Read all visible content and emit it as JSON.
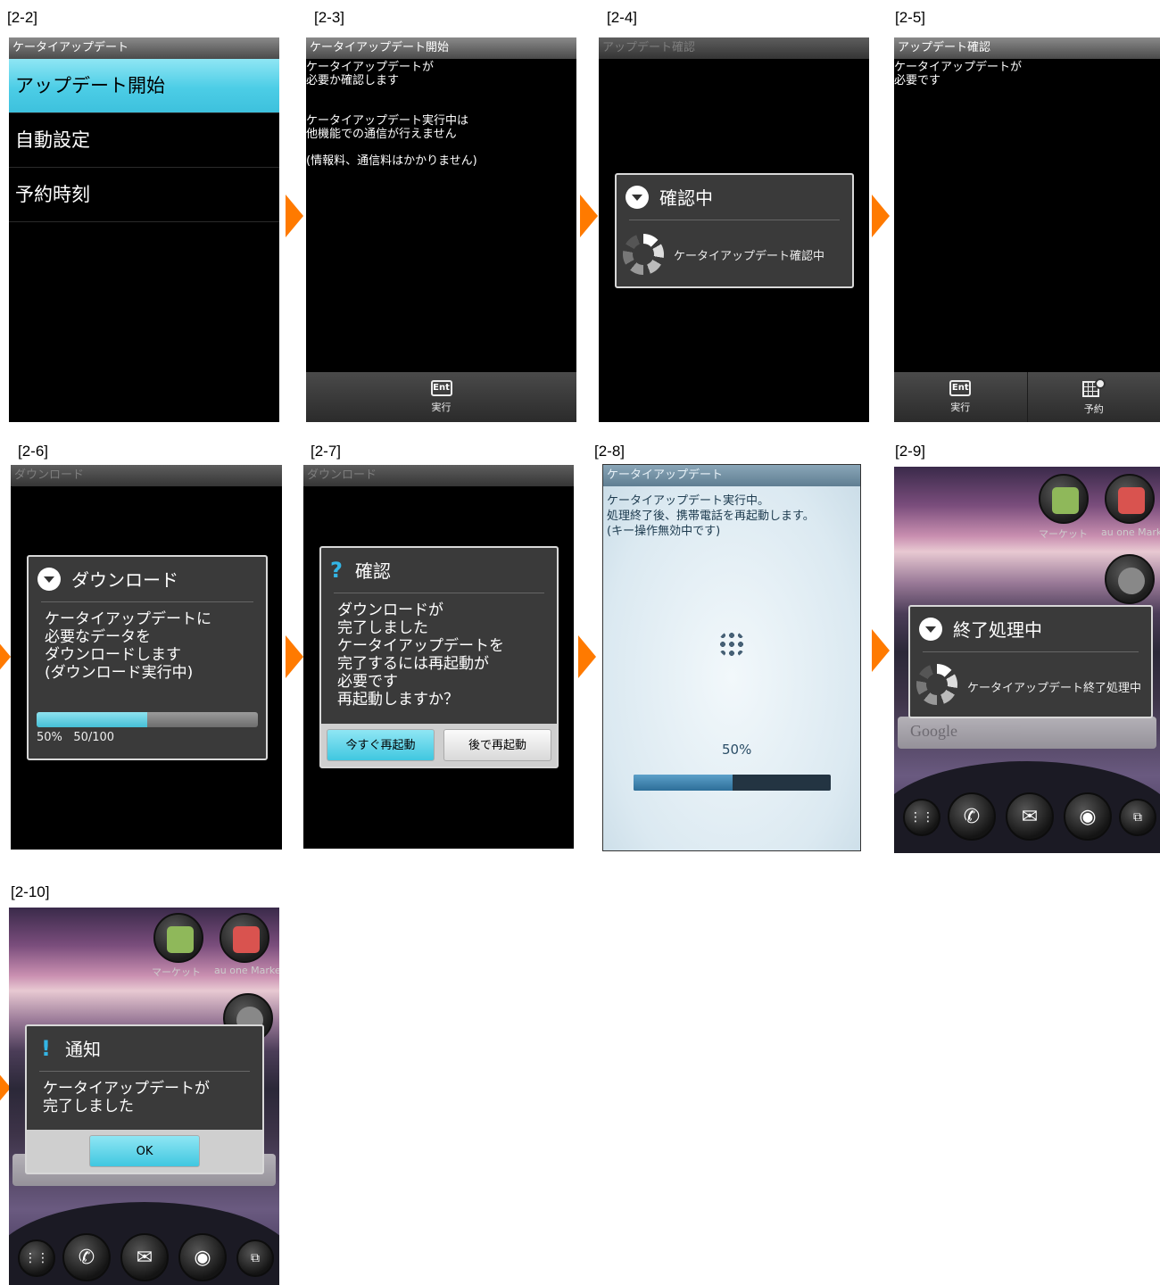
{
  "steps": {
    "s22": "[2-2]",
    "s23": "[2-3]",
    "s24": "[2-4]",
    "s25": "[2-5]",
    "s26": "[2-6]",
    "s27": "[2-7]",
    "s28": "[2-8]",
    "s29": "[2-9]",
    "s210": "[2-10]"
  },
  "screen22": {
    "title": "ケータイアップデート",
    "items": [
      "アップデート開始",
      "自動設定",
      "予約時刻"
    ]
  },
  "screen23": {
    "title": "ケータイアップデート開始",
    "text": "ケータイアップデートが\n必要か確認します\n\n\nケータイアップデート実行中は\n他機能での通信が行えません\n\n(情報料、通信料はかかりません)",
    "softkey_icon": "Ent",
    "softkey_label": "実行"
  },
  "screen24": {
    "title": "アップデート確認",
    "dialog_title": "確認中",
    "message": "ケータイアップデート確認中"
  },
  "screen25": {
    "title": "アップデート確認",
    "text": "ケータイアップデートが\n必要です",
    "softkey_icon": "Ent",
    "softkey1_label": "実行",
    "softkey2_label": "予約"
  },
  "screen26": {
    "title": "ダウンロード",
    "dialog_title": "ダウンロード",
    "message": "ケータイアップデートに\n必要なデータを\nダウンロードします\n(ダウンロード実行中)",
    "progress": 0.5,
    "percent": "50%",
    "count": "50/100"
  },
  "screen27": {
    "title": "ダウンロード",
    "dialog_title": "確認",
    "message": "ダウンロードが\n完了しました\nケータイアップデートを\n完了するには再起動が\n必要です\n再起動しますか？",
    "button1": "今すぐ再起動",
    "button2": "後で再起動"
  },
  "screen28": {
    "title": "ケータイアップデート",
    "text": "ケータイアップデート実行中。\n処理終了後、携帯電話を再起動します。\n(キー操作無効中です)",
    "percent": "50%",
    "progress": 0.5
  },
  "screen29": {
    "app1_label": "マーケット",
    "app2_label": "au one Market",
    "dialog_title": "終了処理中",
    "message": "ケータイアップデート終了処理中",
    "search_text": "Google"
  },
  "screen210": {
    "app1_label": "マーケット",
    "app2_label": "au one Market",
    "dialog_title": "通知",
    "message": "ケータイアップデートが\n完了しました",
    "button": "OK"
  },
  "colors": {
    "accent": "#33b5e5",
    "highlight": "#4ccde6",
    "arrow": "#ff7a00"
  }
}
